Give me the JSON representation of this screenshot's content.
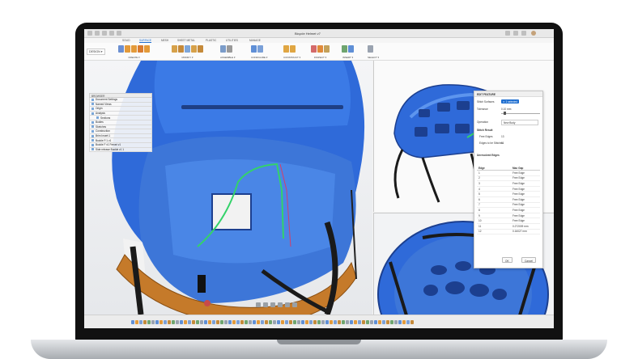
{
  "window": {
    "title": "Bicycle Helmet v7"
  },
  "workspace_tabs": [
    {
      "label": "SOLID",
      "active": false
    },
    {
      "label": "SURFACE",
      "active": true
    },
    {
      "label": "MESH",
      "active": false
    },
    {
      "label": "SHEET METAL",
      "active": false
    },
    {
      "label": "PLASTIC",
      "active": false
    },
    {
      "label": "UTILITIES",
      "active": false
    },
    {
      "label": "MANAGE",
      "active": false
    }
  ],
  "ribbon": {
    "design_button": "DESIGN ▾",
    "groups": [
      {
        "label": "CREATE ▾"
      },
      {
        "label": "MODIFY ▾"
      },
      {
        "label": "ASSEMBLE ▾"
      },
      {
        "label": "CONFIGURE ▾"
      },
      {
        "label": "CONSTRUCT ▾"
      },
      {
        "label": "INSPECT ▾"
      },
      {
        "label": "INSERT ▾"
      },
      {
        "label": "SELECT ▾"
      }
    ]
  },
  "browser": {
    "header": "BROWSER",
    "items": [
      {
        "label": "Document Settings"
      },
      {
        "label": "Named Views"
      },
      {
        "label": "Origin"
      },
      {
        "label": "Analysis"
      },
      {
        "label": "Sections"
      },
      {
        "label": "Bodies"
      },
      {
        "label": "Sketches"
      },
      {
        "label": "Construction"
      },
      {
        "label": "Brim Insert:1"
      },
      {
        "label": "Buckle F:1 v1"
      },
      {
        "label": "Buckle F v1 Ferrari v1"
      },
      {
        "label": "Side release Buckle v1 1"
      }
    ]
  },
  "dialog": {
    "title": "EDIT FEATURE",
    "stitch_surfaces_label": "Stitch Surfaces",
    "stitch_surfaces_value": "✕ 1 selected",
    "tolerance_label": "Tolerance",
    "tolerance_value": "0.10 mm",
    "operation_label": "Operation",
    "operation_value": "New Body",
    "result_section": "Stitch Result",
    "free_edges_label": "Free Edges",
    "free_edges_value": "13",
    "edges_stitched_label": "Edges to be Stitched",
    "edges_stitched_value": "11",
    "unresolved_section": "Unresolved Edges",
    "table_headers": [
      "Edge",
      "Max Gap"
    ],
    "rows": [
      {
        "edge": "1",
        "gap": "Free Edge"
      },
      {
        "edge": "2",
        "gap": "Free Edge"
      },
      {
        "edge": "3",
        "gap": "Free Edge"
      },
      {
        "edge": "4",
        "gap": "Free Edge"
      },
      {
        "edge": "5",
        "gap": "Free Edge"
      },
      {
        "edge": "6",
        "gap": "Free Edge"
      },
      {
        "edge": "7",
        "gap": "Free Edge"
      },
      {
        "edge": "8",
        "gap": "Free Edge"
      },
      {
        "edge": "9",
        "gap": "Free Edge"
      },
      {
        "edge": "10",
        "gap": "Free Edge"
      },
      {
        "edge": "11",
        "gap": "0.272009 mm"
      },
      {
        "edge": "12",
        "gap": "0.16027 mm"
      }
    ],
    "ok": "OK",
    "cancel": "Cancel"
  },
  "colors": {
    "helmet_blue": "#2f6ad9",
    "helmet_dark": "#1c3f8f",
    "padding_orange": "#c57a2a",
    "strap": "#1a1a1a",
    "accent": "#1f6fd0"
  }
}
